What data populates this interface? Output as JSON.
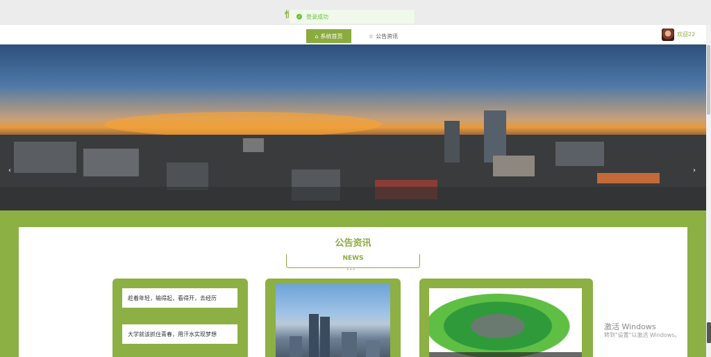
{
  "toast": {
    "message": "登录成功"
  },
  "nav": {
    "home_label": "系统首页",
    "news_label": "公告资讯",
    "username": "欢迎22"
  },
  "banner": {
    "prev": "‹",
    "next": "›"
  },
  "news_section": {
    "title": "公告资讯",
    "subtitle": "NEWS",
    "items": [
      "趁着年轻，输得起，看得开，去经历",
      "大学就该抓住青春，用汗水实现梦想"
    ]
  },
  "watermark": {
    "line1": "激活 Windows",
    "line2": "转到\"设置\"以激活 Windows。"
  },
  "colors": {
    "accent": "#8db045",
    "toast_text": "#67c23a"
  }
}
